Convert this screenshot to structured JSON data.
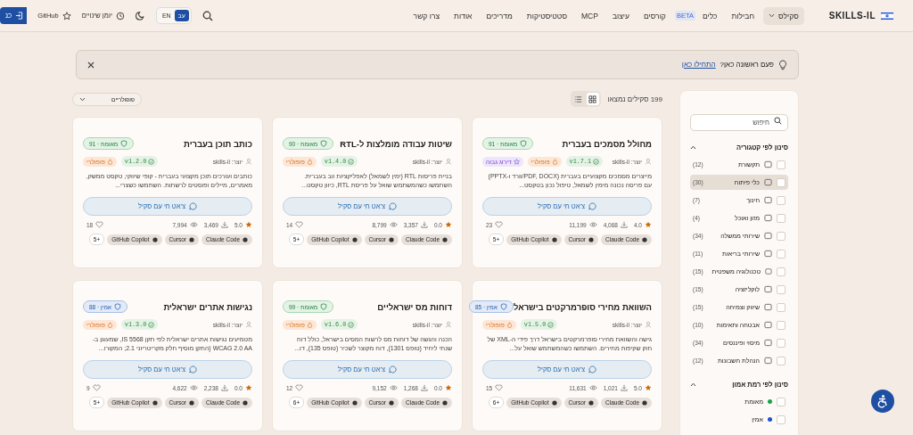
{
  "header": {
    "logo": "SKILLS-IL",
    "nav": [
      {
        "label": "סקילס",
        "selected": true,
        "kind": "dropdown"
      },
      {
        "label": "חבילות",
        "selected": false,
        "kind": "link"
      },
      {
        "label": "כלים",
        "selected": false,
        "kind": "link",
        "badge": "BETA"
      },
      {
        "label": "קורסים",
        "selected": false,
        "kind": "link"
      },
      {
        "label": "עיצוב",
        "selected": false,
        "kind": "link"
      },
      {
        "label": "MCP",
        "selected": false,
        "kind": "link"
      },
      {
        "label": "סטטיסטיקות",
        "selected": false,
        "kind": "link"
      },
      {
        "label": "מדריכים",
        "selected": false,
        "kind": "link"
      },
      {
        "label": "אודות",
        "selected": false,
        "kind": "link"
      },
      {
        "label": "צרו קשר",
        "selected": false,
        "kind": "link"
      }
    ],
    "languages": [
      {
        "label": "עב",
        "selected": true
      },
      {
        "label": "EN",
        "selected": false
      }
    ],
    "changelog": "יומן שינויים",
    "github": "GitHub",
    "login": "כנ"
  },
  "banner": {
    "text": "פעם ראשונה כאן?",
    "link": "התחילו כאן"
  },
  "toolbar": {
    "count": "199 סקילים נמצאו",
    "views": [
      {
        "kind": "grid",
        "selected": true
      },
      {
        "kind": "list",
        "selected": false
      }
    ],
    "sort": "פופולריים"
  },
  "sidebar": {
    "search_placeholder": "חיפוש",
    "sections": [
      {
        "title": "סינון לפי קטגוריה",
        "expanded": true,
        "items": [
          {
            "label": "תקשורת",
            "count": "(12)",
            "checked": false,
            "selected": false
          },
          {
            "label": "כלי פיתוח",
            "count": "(30)",
            "checked": false,
            "selected": true
          },
          {
            "label": "חינוך",
            "count": "(7)",
            "checked": false,
            "selected": false
          },
          {
            "label": "מזון ואוכל",
            "count": "(4)",
            "checked": false,
            "selected": false
          },
          {
            "label": "שירותי ממשלה",
            "count": "(34)",
            "checked": false,
            "selected": false
          },
          {
            "label": "שירותי בריאות",
            "count": "(11)",
            "checked": false,
            "selected": false
          },
          {
            "label": "טכנולוגיה משפטית",
            "count": "(15)",
            "checked": false,
            "selected": false
          },
          {
            "label": "לוקליזציה",
            "count": "(15)",
            "checked": false,
            "selected": false
          },
          {
            "label": "שיווק וצמיחה",
            "count": "(15)",
            "checked": false,
            "selected": false
          },
          {
            "label": "אבטחה ותאימות",
            "count": "(10)",
            "checked": false,
            "selected": false
          },
          {
            "label": "מיסוי ופיננסים",
            "count": "(34)",
            "checked": false,
            "selected": false
          },
          {
            "label": "הנהלת חשבונות",
            "count": "(12)",
            "checked": false,
            "selected": false
          }
        ]
      },
      {
        "title": "סינון לפי רמת אמון",
        "expanded": true,
        "items": [
          {
            "label": "מאומת",
            "color": "#16a34a",
            "checked": false,
            "selected": false
          },
          {
            "label": "אמין",
            "color": "#1d4ed8",
            "checked": false,
            "selected": false
          }
        ]
      }
    ]
  },
  "cards": [
    {
      "title": "מחולל מסמכים בעברית",
      "trust": {
        "kind": "verified",
        "label": "מאומת · 91"
      },
      "author": "יוצר: skills-il",
      "tags": [
        {
          "kind": "version",
          "label": "v1.7.1"
        },
        {
          "kind": "popular",
          "label": "פופולרי"
        },
        {
          "kind": "top",
          "label": "דירוג גבוה"
        }
      ],
      "description": "מייצרים מסמכים מקצועיים בעברית (PDF, DOCX/וורד ו-PPTX) עם פריסה נכונה מימין לשמאל, טיפול נכון בטקסט...",
      "button": "צ'אט חי עם סקיל",
      "rating": "4.0",
      "downloads": "4,068",
      "views": "11,199",
      "likes": "23",
      "platforms": [
        "Claude Code",
        "Cursor",
        "GitHub Copilot"
      ],
      "more": "5+"
    },
    {
      "title": "שיטות עבודה מומלצות ל-RTL",
      "trust": {
        "kind": "verified",
        "label": "מאומת · 90"
      },
      "author": "יוצר: skills-il",
      "tags": [
        {
          "kind": "version",
          "label": "v1.4.0"
        },
        {
          "kind": "popular",
          "label": "פופולרי"
        }
      ],
      "description": "בניית פריסות RTL (ימין לשמאל) לאפליקציות ווב בעברית. השתמשו כשהמשתמש שואל על פריסת RTL, כיוון טקסט...",
      "button": "צ'אט חי עם סקיל",
      "rating": "0.0",
      "downloads": "3,357",
      "views": "8,799",
      "likes": "14",
      "platforms": [
        "Claude Code",
        "Cursor",
        "GitHub Copilot"
      ],
      "more": "5+"
    },
    {
      "title": "כותב תוכן בעברית",
      "trust": {
        "kind": "verified",
        "label": "מאומת · 91"
      },
      "author": "יוצר: skills-il",
      "tags": [
        {
          "kind": "version",
          "label": "v1.2.0"
        },
        {
          "kind": "popular",
          "label": "פופולרי"
        }
      ],
      "description": "כותבים ועורכים תוכן מקצועי בעברית - קופי שיווקי, טקסט ממשק, מאמרים, מיילים ופוסטים לרשתות. השתמשו כשצרי...",
      "button": "צ'אט חי עם סקיל",
      "rating": "5.0",
      "downloads": "3,469",
      "views": "7,994",
      "likes": "18",
      "platforms": [
        "Claude Code",
        "Cursor",
        "GitHub Copilot"
      ],
      "more": "5+"
    },
    {
      "title": "השוואת מחירי סופרמרקטים בישראל",
      "trust": {
        "kind": "trusted",
        "label": "אמין · 85"
      },
      "author": "יוצר: skills-il",
      "tags": [
        {
          "kind": "version",
          "label": "v1.5.0"
        },
        {
          "kind": "popular",
          "label": "פופולרי"
        }
      ],
      "description": "גישה והשוואת מחירי סופרמרקטים בישראל דרך פידי ה-XML של חוק שקיפות מחירים. השתמשו כשהמשתמש שואל על...",
      "button": "צ'אט חי עם סקיל",
      "rating": "5.0",
      "downloads": "1,021",
      "views": "11,631",
      "likes": "15",
      "platforms": [
        "Claude Code",
        "Cursor",
        "GitHub Copilot"
      ],
      "more": "6+"
    },
    {
      "title": "דוחות מס ישראליים",
      "trust": {
        "kind": "verified",
        "label": "מאומת · 99"
      },
      "author": "יוצר: skills-il",
      "tags": [
        {
          "kind": "version",
          "label": "v1.6.0"
        },
        {
          "kind": "popular",
          "label": "פופולרי"
        }
      ],
      "description": "הכנה והגשה של דוחות מס לרשות המסים בישראל, כולל דוח שנתי ליחיד (טופס 1301), דוח מקוצר לשכיר (טופס 135), דו...",
      "button": "צ'אט חי עם סקיל",
      "rating": "0.0",
      "downloads": "1,268",
      "views": "9,152",
      "likes": "12",
      "platforms": [
        "Claude Code",
        "Cursor",
        "GitHub Copilot"
      ],
      "more": "6+"
    },
    {
      "title": "נגישות אתרים ישראלית",
      "trust": {
        "kind": "trusted",
        "label": "אמין · 88"
      },
      "author": "יוצר: skills-il",
      "tags": [
        {
          "kind": "version",
          "label": "v1.3.0"
        },
        {
          "kind": "popular",
          "label": "פופולרי"
        }
      ],
      "description": "מטמיעים נגישות אתרים ישראלית לפי תקן IS 5568, שמעוגן ב-WCAG 2.0 AA (התקן מוסיף חלק מקריטריוני 2.1; המקורו...",
      "button": "צ'אט חי עם סקיל",
      "rating": "0.0",
      "downloads": "2,238",
      "views": "4,622",
      "likes": "9",
      "platforms": [
        "Claude Code",
        "Cursor",
        "GitHub Copilot"
      ],
      "more": "5+"
    }
  ]
}
